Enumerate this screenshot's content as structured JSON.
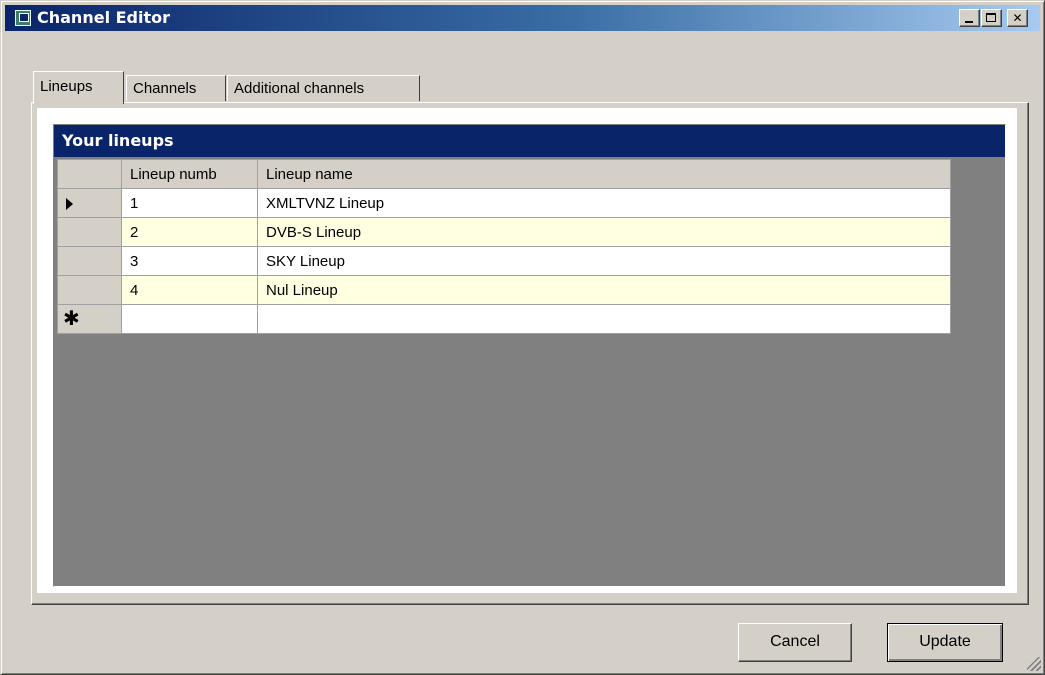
{
  "window": {
    "title": "Channel Editor",
    "minimize_label": "_",
    "close_label": "✕"
  },
  "tabs": [
    {
      "label": "Lineups",
      "active": true
    },
    {
      "label": "Channels",
      "active": false
    },
    {
      "label": "Additional channels",
      "active": false
    }
  ],
  "grid": {
    "caption": "Your lineups",
    "columns": [
      "Lineup numb",
      "Lineup name"
    ],
    "rows": [
      {
        "number": "1",
        "name": "XMLTVNZ Lineup",
        "current": true
      },
      {
        "number": "2",
        "name": "DVB-S Lineup",
        "current": false
      },
      {
        "number": "3",
        "name": "SKY Lineup",
        "current": false
      },
      {
        "number": "4",
        "name": "Nul Lineup",
        "current": false
      }
    ],
    "new_row_marker": "✱"
  },
  "buttons": {
    "cancel": "Cancel",
    "update": "Update"
  },
  "colors": {
    "title_gradient_start": "#0a246a",
    "caption_background": "#0a246a",
    "alt_row": "#ffffe1",
    "grid_background": "#808080",
    "face": "#d4d0c8"
  }
}
